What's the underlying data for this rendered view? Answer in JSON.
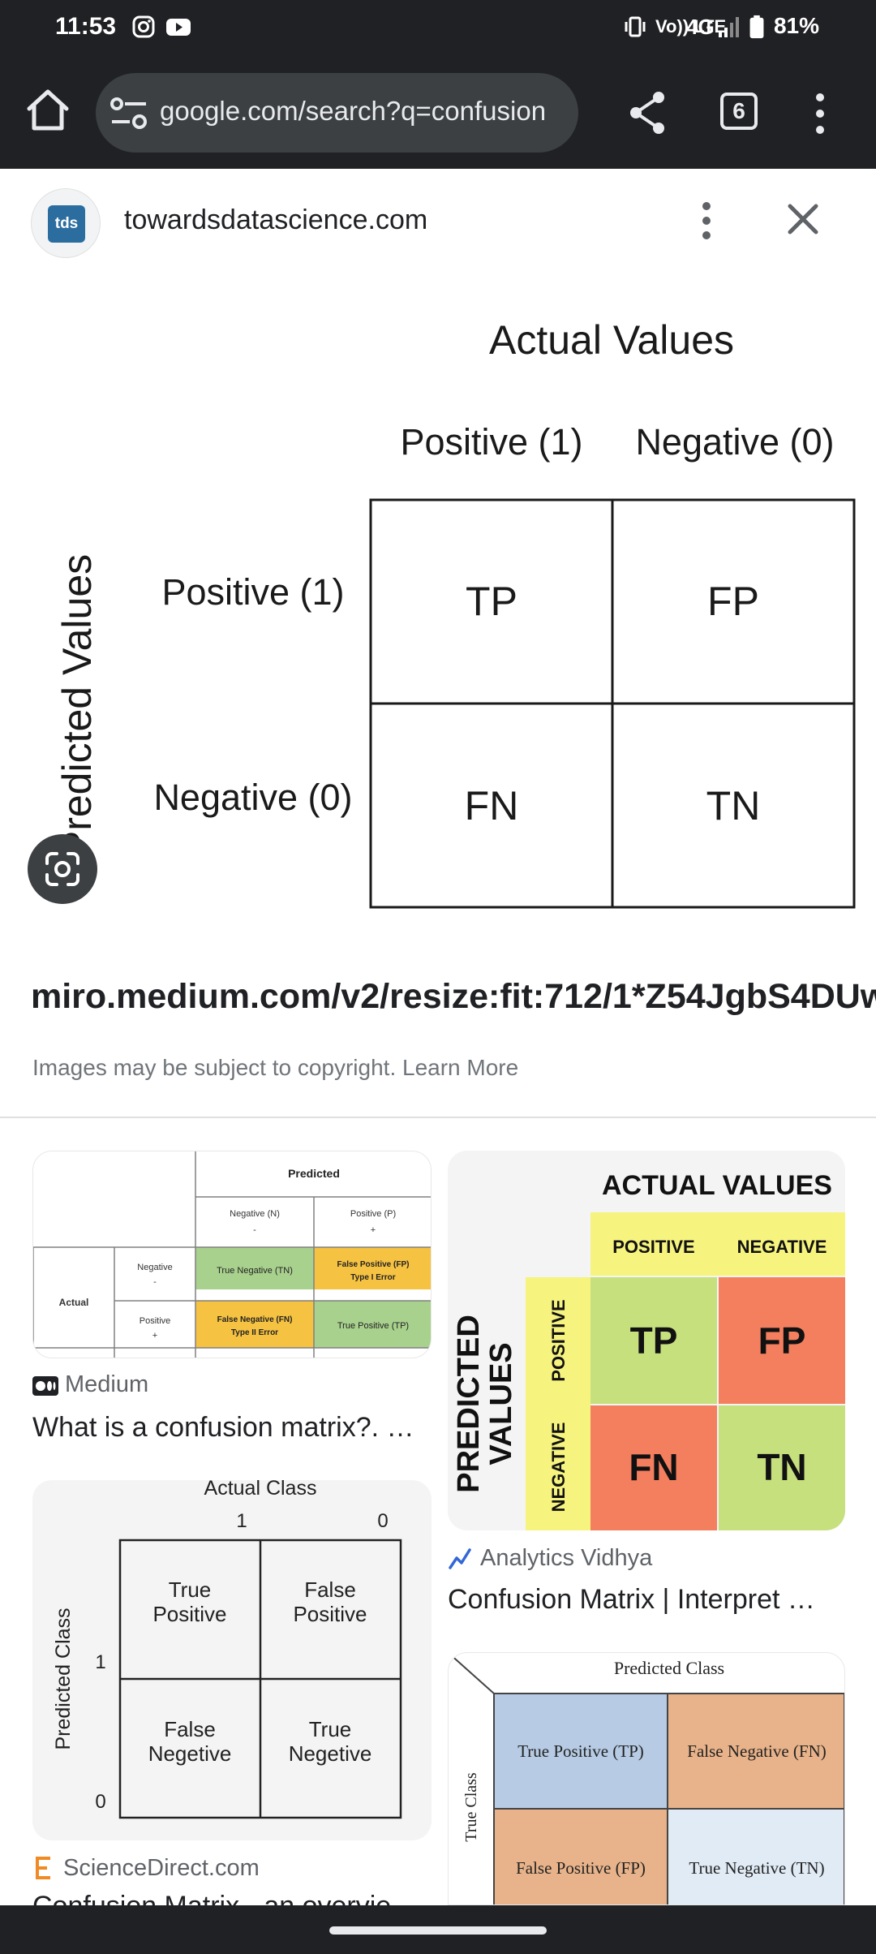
{
  "status_bar": {
    "time": "11:53",
    "network": "4G",
    "volte": "Vo)) LTE",
    "battery": "81%"
  },
  "browser": {
    "url": "google.com/search?q=confusion",
    "tab_count": "6"
  },
  "viewer": {
    "site_logo_text": "tds",
    "site_name": "towardsdatascience.com",
    "image_url": "miro.medium.com/v2/resize:fit:712/1*Z54JgbS4DUwWSknhDCvNTQ.png",
    "copyright_text": "Images may be subject to copyright.",
    "learn_more": "Learn More"
  },
  "main_image": {
    "actual_title": "Actual Values",
    "predicted_title": "Predicted Values",
    "col_headers": [
      "Positive (1)",
      "Negative (0)"
    ],
    "row_headers": [
      "Positive (1)",
      "Negative (0)"
    ],
    "cells": [
      [
        "TP",
        "FP"
      ],
      [
        "FN",
        "TN"
      ]
    ]
  },
  "results": [
    {
      "source": "Medium",
      "title": "What is a confusion matrix?. …",
      "thumb": {
        "predicted": "Predicted",
        "neg_header": "Negative (N)",
        "neg_sign": "-",
        "pos_header": "Positive (P)",
        "pos_sign": "+",
        "actual": "Actual",
        "row_neg": "Negative",
        "row_neg_sign": "-",
        "row_pos": "Positive",
        "row_pos_sign": "+",
        "tn": "True Negative (TN)",
        "fp_1": "False Positive (FP)",
        "fp_2": "Type I Error",
        "fn_1": "False Negative (FN)",
        "fn_2": "Type II Error",
        "tp": "True Positive (TP)"
      }
    },
    {
      "source": "Analytics Vidhya",
      "title": "Confusion Matrix | Interpret …",
      "thumb": {
        "actual": "ACTUAL VALUES",
        "positive": "POSITIVE",
        "negative": "NEGATIVE",
        "predicted_1": "PREDICTED",
        "predicted_2": "VALUES",
        "row_pos": "POSITIVE",
        "row_neg": "NEGATIVE",
        "tp": "TP",
        "fp": "FP",
        "fn": "FN",
        "tn": "TN"
      }
    },
    {
      "source": "ScienceDirect.com",
      "title": "Confusion Matrix - an overvie",
      "thumb": {
        "actual": "Actual Class",
        "col_1": "1",
        "col_0": "0",
        "predicted": "Predicted Class",
        "row_1": "1",
        "row_0": "0",
        "tp_1": "True",
        "tp_2": "Positive",
        "fp_1": "False",
        "fp_2": "Positive",
        "fn_1": "False",
        "fn_2": "Negetive",
        "tn_1": "True",
        "tn_2": "Negetive"
      }
    },
    {
      "thumb": {
        "predicted": "Predicted Class",
        "true_class": "True Class",
        "tp": "True Positive (TP)",
        "fn": "False Negative (FN)",
        "fp": "False Positive (FP)",
        "tn": "True Negative (TN)"
      }
    }
  ],
  "colors": {
    "chrome": "#202124",
    "urlbar": "#3c4043",
    "green_cell": "#c6e07e",
    "orange_cell": "#f47f5f",
    "yellow_header": "#f6f47e",
    "tds_blue": "#2c6da0",
    "sciencedirect_orange": "#f08a24"
  }
}
